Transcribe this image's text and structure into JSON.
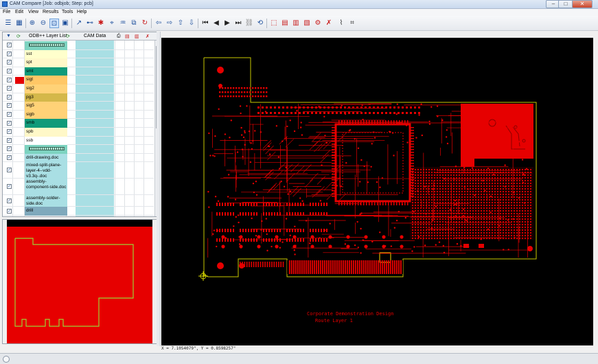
{
  "window": {
    "title": "CAM Compare [Job: odbjob; Step: pcb]",
    "minimize": "–",
    "maximize": "□",
    "close": "✕"
  },
  "menu": [
    "File",
    "Edit",
    "View",
    "Results",
    "Tools",
    "Help"
  ],
  "toolbar_icons": [
    "list-view-icon",
    "tree-view-icon",
    "zoom-in-icon",
    "zoom-out-icon",
    "zoom-window-icon",
    "zoom-fit-icon",
    "cross-probe-icon",
    "measure-icon",
    "snap-icon",
    "find-icon",
    "select-icon",
    "rotate-icon",
    "pan-left-icon",
    "pan-right-icon",
    "pan-up-icon",
    "pan-down-icon",
    "first-icon",
    "previous-icon",
    "next-icon",
    "last-icon",
    "link-icon",
    "refresh-icon",
    "highlight-icon",
    "compare-icon",
    "compare-layers-icon",
    "compare-flags-icon",
    "clear-results-icon",
    "net-icon",
    "net-compare-icon"
  ],
  "layer_list": {
    "header_odb": "ODB++ Layer List",
    "header_cam": "CAM Data",
    "colors": {
      "top": "#e60000",
      "signal_light": "#ffc766",
      "signal": "#ffd277",
      "soldermask": "#109a7a",
      "silk": "#ffffcc",
      "paste": "#fff8c8",
      "plane": "#d4b84a",
      "drill": "#7fa9bc",
      "doc": "#a9dfe4",
      "cam": "#a9dfe4"
    },
    "rows": [
      {
        "name": "",
        "kind": "header",
        "color": "#7dd3c0"
      },
      {
        "name": "sst",
        "kind": "layer",
        "color": "#ffffcc"
      },
      {
        "name": "spt",
        "kind": "layer",
        "color": "#fff8c8"
      },
      {
        "name": "smt",
        "kind": "layer",
        "color": "#109a7a"
      },
      {
        "name": "sigt",
        "kind": "layer",
        "color": "#ffc766",
        "active": true
      },
      {
        "name": "sig2",
        "kind": "layer",
        "color": "#ffd277"
      },
      {
        "name": "pg3",
        "kind": "layer",
        "color": "#d4b84a"
      },
      {
        "name": "sig5",
        "kind": "layer",
        "color": "#ffd277"
      },
      {
        "name": "sigb",
        "kind": "layer",
        "color": "#ffd277"
      },
      {
        "name": "smb",
        "kind": "layer",
        "color": "#109a7a"
      },
      {
        "name": "spb",
        "kind": "layer",
        "color": "#fff8c8"
      },
      {
        "name": "ssb",
        "kind": "layer",
        "color": "#ffffff"
      },
      {
        "name": "",
        "kind": "header",
        "color": "#7dd3c0"
      },
      {
        "name": "drill-drawing.doc",
        "kind": "doc",
        "color": "#a9dfe4"
      },
      {
        "name": "mixed-split-plane-layer-4--vdd-v3.3q-.doc",
        "kind": "doc",
        "color": "#a9dfe4",
        "lines": 3
      },
      {
        "name": "assembly-component-side.doc",
        "kind": "doc",
        "color": "#a9dfe4",
        "lines": 3
      },
      {
        "name": "assembly-solder-side.doc",
        "kind": "doc",
        "color": "#a9dfe4",
        "lines": 2
      },
      {
        "name": "drill",
        "kind": "layer",
        "color": "#7fa9bc"
      }
    ]
  },
  "canvas": {
    "note_line1": "Corporate Demonstration Design",
    "note_line2": "Route Layer 1"
  },
  "status": {
    "coordinates": "X = 7.1054079\", Y = 0.8598257\""
  }
}
